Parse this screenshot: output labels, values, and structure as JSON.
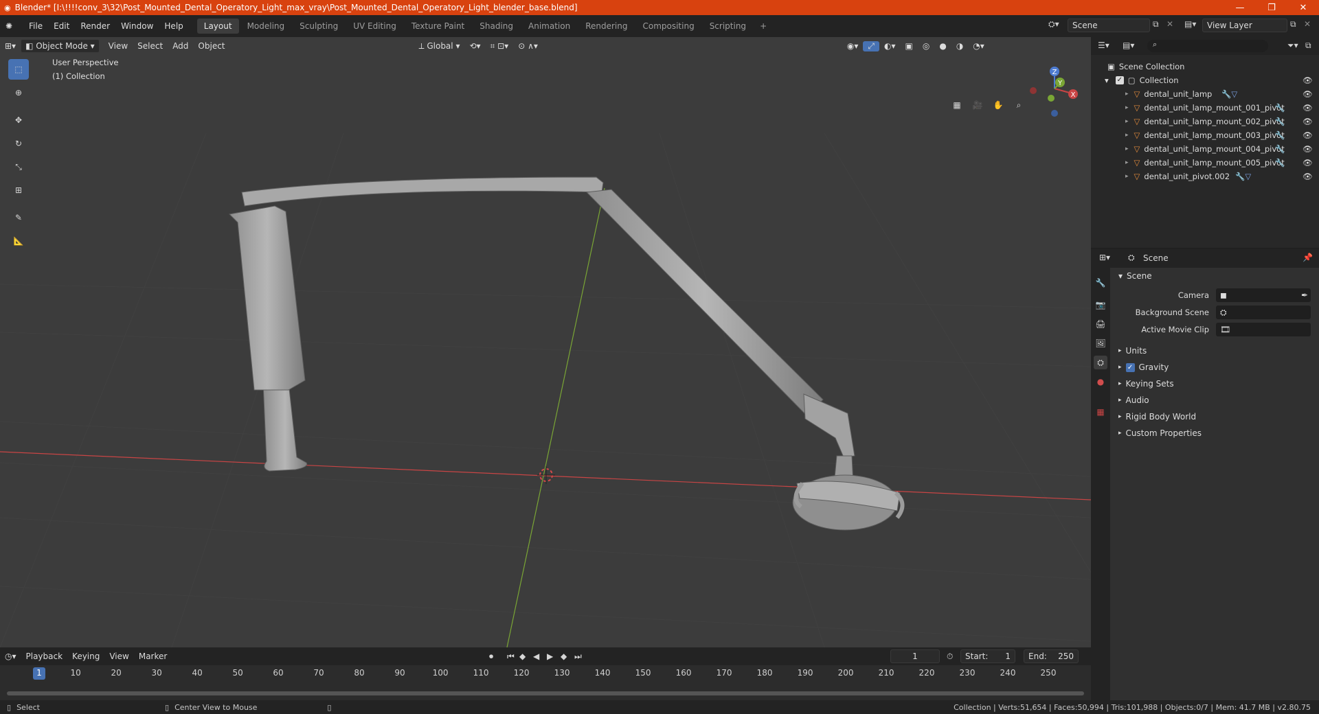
{
  "window": {
    "title": "Blender* [I:\\!!!!conv_3\\32\\Post_Mounted_Dental_Operatory_Light_max_vray\\Post_Mounted_Dental_Operatory_Light_blender_base.blend]",
    "minimize": "—",
    "maximize": "❐",
    "close": "✕"
  },
  "menubar": [
    "File",
    "Edit",
    "Render",
    "Window",
    "Help"
  ],
  "workspaces": [
    {
      "label": "Layout",
      "active": true
    },
    {
      "label": "Modeling"
    },
    {
      "label": "Sculpting"
    },
    {
      "label": "UV Editing"
    },
    {
      "label": "Texture Paint"
    },
    {
      "label": "Shading"
    },
    {
      "label": "Animation"
    },
    {
      "label": "Rendering"
    },
    {
      "label": "Compositing"
    },
    {
      "label": "Scripting"
    }
  ],
  "workspace_add": "+",
  "scene_field": "Scene",
  "view_layer_field": "View Layer",
  "viewport_header": {
    "mode": "Object Mode",
    "menus": [
      "View",
      "Select",
      "Add",
      "Object"
    ],
    "orientation": "Global"
  },
  "viewport": {
    "perspective": "User Perspective",
    "collection": "(1) Collection",
    "gizmo": {
      "x": "X",
      "y": "Y",
      "z": "Z"
    }
  },
  "outliner": {
    "root": "Scene Collection",
    "collection": "Collection",
    "items": [
      {
        "label": "dental_unit_lamp",
        "extra": "mesh"
      },
      {
        "label": "dental_unit_lamp_mount_001_pivot",
        "extra": "mod"
      },
      {
        "label": "dental_unit_lamp_mount_002_pivot",
        "extra": "mod"
      },
      {
        "label": "dental_unit_lamp_mount_003_pivot",
        "extra": "mod"
      },
      {
        "label": "dental_unit_lamp_mount_004_pivot",
        "extra": "mod"
      },
      {
        "label": "dental_unit_lamp_mount_005_pivot",
        "extra": "mod"
      },
      {
        "label": "dental_unit_pivot.002",
        "extra": "mesh"
      }
    ]
  },
  "properties": {
    "header": "Scene",
    "panel_title": "Scene",
    "fields": [
      {
        "label": "Camera",
        "value": ""
      },
      {
        "label": "Background Scene",
        "value": ""
      },
      {
        "label": "Active Movie Clip",
        "value": ""
      }
    ],
    "sections": [
      {
        "label": "Units",
        "checkbox": false
      },
      {
        "label": "Gravity",
        "checkbox": true
      },
      {
        "label": "Keying Sets",
        "checkbox": false
      },
      {
        "label": "Audio",
        "checkbox": false
      },
      {
        "label": "Rigid Body World",
        "checkbox": false
      },
      {
        "label": "Custom Properties",
        "checkbox": false
      }
    ]
  },
  "timeline": {
    "menus": [
      "Playback",
      "Keying",
      "View",
      "Marker"
    ],
    "current_frame": "1",
    "start_label": "Start:",
    "start": "1",
    "end_label": "End:",
    "end": "250",
    "ruler": [
      "1",
      "10",
      "20",
      "30",
      "40",
      "50",
      "60",
      "70",
      "80",
      "90",
      "100",
      "110",
      "120",
      "130",
      "140",
      "150",
      "160",
      "170",
      "180",
      "190",
      "200",
      "210",
      "220",
      "230",
      "240",
      "250"
    ]
  },
  "statusbar": {
    "select": "Select",
    "center": "Center View to Mouse",
    "stats": "Collection | Verts:51,654 | Faces:50,994 | Tris:101,988 | Objects:0/7 | Mem: 41.7 MB | v2.80.75"
  },
  "colors": {
    "titlebar": "#d8420f",
    "accent": "#4772b3",
    "x_axis": "#c94545",
    "y_axis": "#7aa635",
    "z_axis": "#4d7bd1"
  }
}
